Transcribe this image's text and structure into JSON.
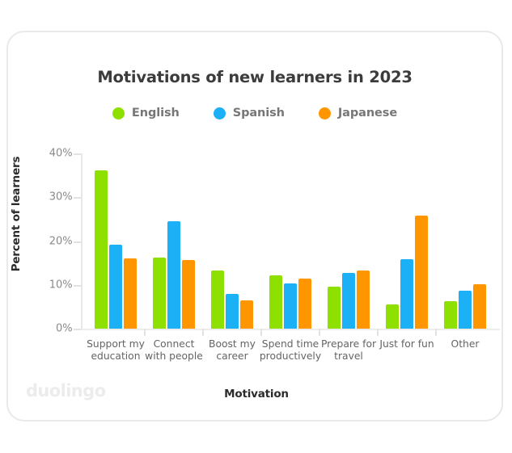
{
  "chart_data": {
    "type": "bar",
    "title": "Motivations of new learners in 2023",
    "xlabel": "Motivation",
    "ylabel": "Percent of learners",
    "ylim": [
      0,
      40
    ],
    "ytick_labels": [
      "0%",
      "10%",
      "20%",
      "30%",
      "40%"
    ],
    "ytick_values": [
      0,
      10,
      20,
      30,
      40
    ],
    "grid": false,
    "legend_position": "top-center",
    "categories": [
      "Support my education",
      "Connect with people",
      "Boost my career",
      "Spend time productively",
      "Prepare for travel",
      "Just for fun",
      "Other"
    ],
    "category_lines": [
      [
        "Support my",
        "education"
      ],
      [
        "Connect",
        "with people"
      ],
      [
        "Boost my",
        "career"
      ],
      [
        "Spend time",
        "productively"
      ],
      [
        "Prepare for",
        "travel"
      ],
      [
        "Just for fun",
        ""
      ],
      [
        "Other",
        ""
      ]
    ],
    "series": [
      {
        "name": "English",
        "color": "#8ee000",
        "values": [
          36.2,
          16.2,
          13.2,
          12.1,
          9.5,
          5.6,
          6.3
        ]
      },
      {
        "name": "Spanish",
        "color": "#1cb0f6",
        "values": [
          19.1,
          24.6,
          8.0,
          10.3,
          12.8,
          15.9,
          8.6
        ]
      },
      {
        "name": "Japanese",
        "color": "#ff9600",
        "values": [
          16.0,
          15.6,
          6.5,
          11.4,
          13.2,
          25.8,
          10.2
        ]
      }
    ]
  },
  "watermark": "duolingo",
  "colors": {
    "english": "#8ee000",
    "spanish": "#1cb0f6",
    "japanese": "#ff9600",
    "title_text": "#3c3c3c",
    "axis_text": "#8a8a8a",
    "card_border": "#e9e9e9"
  }
}
